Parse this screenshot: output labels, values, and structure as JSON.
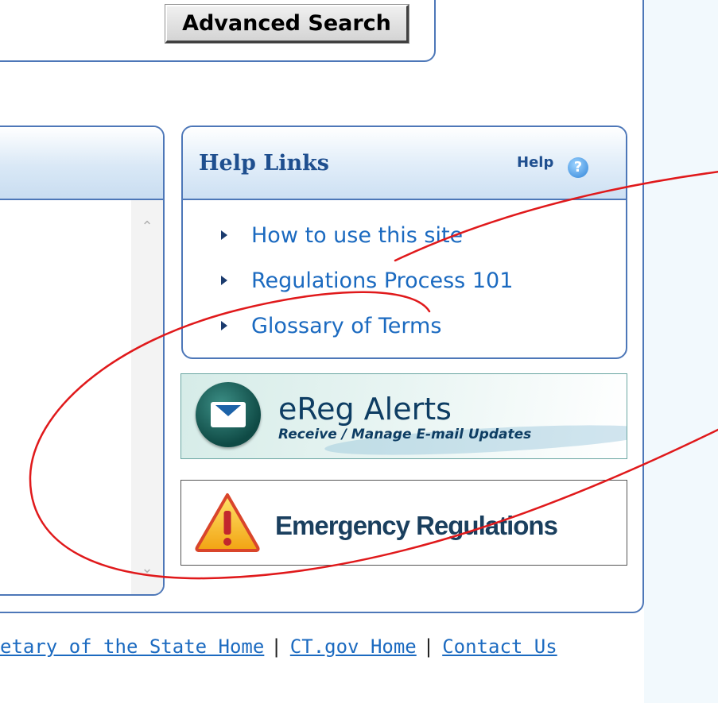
{
  "search": {
    "advanced_button_label": "Advanced Search"
  },
  "help_links": {
    "title": "Help Links",
    "help_label": "Help",
    "items": [
      {
        "label": "How to use this site"
      },
      {
        "label": "Regulations Process 101"
      },
      {
        "label": "Glossary of Terms"
      }
    ]
  },
  "banners": {
    "ereg": {
      "title": "eReg Alerts",
      "subtitle": "Receive / Manage E-mail Updates",
      "icon": "envelope-icon"
    },
    "emergency": {
      "title": "Emergency Regulations",
      "icon": "warning-icon"
    }
  },
  "footer": {
    "links": [
      {
        "label": "etary of the State Home"
      },
      {
        "label": "CT.gov Home"
      },
      {
        "label": "Contact Us"
      }
    ],
    "separator": "|"
  },
  "annotation": {
    "color": "#e0191b"
  },
  "colors": {
    "frame_border": "#4d77b8",
    "link": "#1b6ac0",
    "heading": "#1f4f8f",
    "right_background": "#f2f9fd"
  }
}
